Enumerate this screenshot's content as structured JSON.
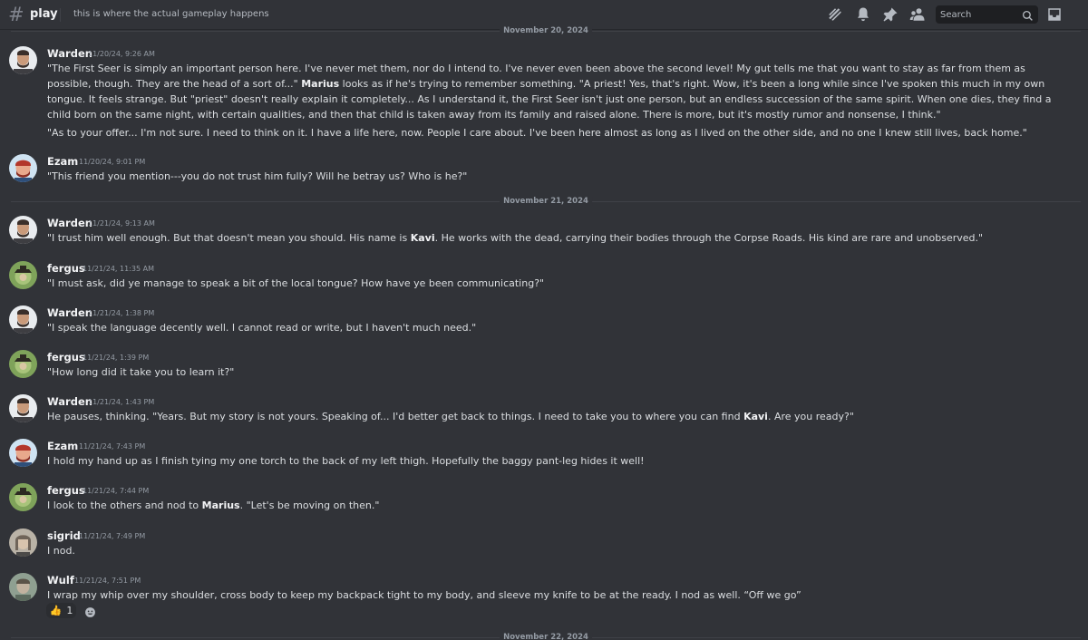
{
  "header": {
    "channel": "play",
    "topic": "this is where the actual gameplay happens",
    "search_placeholder": "Search",
    "icons": [
      "threads-icon",
      "bell-icon",
      "pin-icon",
      "members-icon",
      "search-icon",
      "inbox-icon"
    ]
  },
  "dates": {
    "top": "November 20, 2024",
    "mid": "November 21, 2024",
    "bottom": "November 22, 2024"
  },
  "messages": [
    {
      "user": "Warden",
      "time": "11/20/24, 9:26 AM",
      "p1_a": "\"The First Seer is simply an important person here. I've never met them, nor do I intend to. I've never even been above the second level! My gut tells me that you want to stay as far from them as possible, though. They are the head of a sort of...\" ",
      "p1_bold": "Marius",
      "p1_b": " looks as if he's trying to remember something. \"A priest! Yes, that's right. Wow, it's been a long while since I've spoken this much in my own tongue. It feels strange. But \"priest\" doesn't really explain it completely... As I understand it, the First Seer isn't just one person, but an endless succession of the same spirit. When one dies, they find a child born on the same night, with certain qualities, and then that child is taken away from its family and raised alone. There is more, but it's mostly rumor and nonsense, I think.\"",
      "p2": "\"As to your offer... I'm not sure. I need to think on it. I have a life here, now. People I care about. I've been here almost as long as I lived on the other side, and no one I knew still lives, back home.\""
    },
    {
      "user": "Ezam",
      "time": "11/20/24, 9:01 PM",
      "text": "\"This friend you mention---you do not trust him fully? Will he betray us? Who is he?\""
    },
    {
      "user": "Warden",
      "time": "11/21/24, 9:13 AM",
      "text_a": "\"I trust him well enough. But that doesn't mean you should. His name is ",
      "text_bold": "Kavi",
      "text_b": ". He works with the dead, carrying their bodies through the Corpse Roads. His kind are rare and unobserved.\""
    },
    {
      "user": "fergus",
      "time": "11/21/24, 11:35 AM",
      "text": "\"I must ask, did ye manage to speak a bit of the local tongue? How have ye been communicating?\""
    },
    {
      "user": "Warden",
      "time": "11/21/24, 1:38 PM",
      "text": "\"I speak the language decently well. I cannot read or write, but I haven't much need.\""
    },
    {
      "user": "fergus",
      "time": "11/21/24, 1:39 PM",
      "text": "\"How long did it take you to learn it?\""
    },
    {
      "user": "Warden",
      "time": "11/21/24, 1:43 PM",
      "text_a": "He pauses, thinking. \"Years. But my story is not yours. Speaking of... I'd better get back to things. I need to take you to where you can find ",
      "text_bold": "Kavi",
      "text_b": ". Are you ready?\""
    },
    {
      "user": "Ezam",
      "time": "11/21/24, 7:43 PM",
      "text": "I hold my hand up as I finish tying my one torch to the back of my left thigh. Hopefully the baggy pant-leg hides it well!"
    },
    {
      "user": "fergus",
      "time": "11/21/24, 7:44 PM",
      "text_a": "I look to the others and nod to ",
      "text_bold": "Marius",
      "text_b": ". \"Let's be moving on then.\""
    },
    {
      "user": "sigrid",
      "time": "11/21/24, 7:49 PM",
      "text": "I nod."
    },
    {
      "user": "Wulf",
      "time": "11/21/24, 7:51 PM",
      "text": "I wrap my whip over my shoulder, cross body to keep my backpack tight to my body, and sleeve my knife to be at the ready. I nod as well. “Off we go”",
      "reaction_emoji": "👍",
      "reaction_count": "1"
    }
  ],
  "colors": {
    "background": "#313338",
    "text": "#dbdee1",
    "username": "#f2f3f5",
    "muted": "#949ba4"
  }
}
